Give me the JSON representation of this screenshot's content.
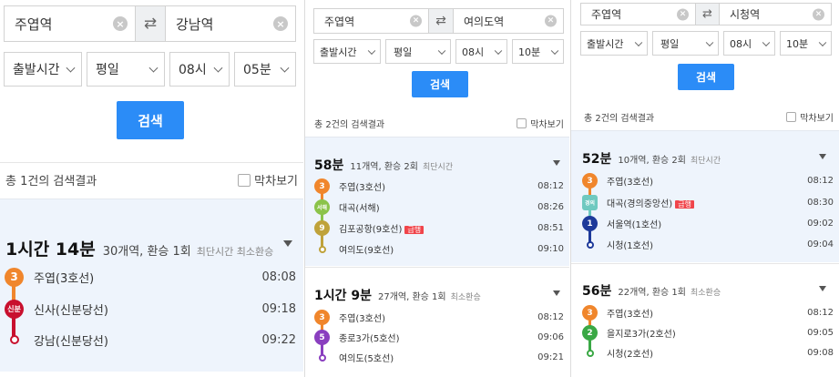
{
  "panel1": {
    "from": "주엽역",
    "to": "강남역",
    "dep_label": "출발시간",
    "day": "평일",
    "hour": "08시",
    "minute": "05분",
    "search": "검색",
    "result_count": "총 1건의 검색결과",
    "toggle": "막차보기",
    "routes": [
      {
        "time": "1시간 14분",
        "info": "30개역, 환승 1회",
        "tags": "최단시간 최소환승",
        "stops": [
          {
            "badge": "3",
            "name": "주엽(3호선)",
            "time": "08:08",
            "color": "#f0862c"
          },
          {
            "badge": "신분",
            "name": "신사(신분당선)",
            "time": "09:18",
            "color": "#c8102e"
          },
          {
            "badge": "",
            "name": "강남(신분당선)",
            "time": "09:22",
            "color": "#c8102e"
          }
        ]
      }
    ]
  },
  "panel2": {
    "from": "주엽역",
    "to": "여의도역",
    "dep_label": "출발시간",
    "day": "평일",
    "hour": "08시",
    "minute": "10분",
    "search": "검색",
    "result_count": "총 2건의 검색결과",
    "toggle": "막차보기",
    "routes": [
      {
        "time": "58분",
        "info": "11개역, 환승 2회",
        "tags": "최단시간",
        "stops": [
          {
            "badge": "3",
            "name": "주엽(3호선)",
            "time": "08:12",
            "color": "#f0862c"
          },
          {
            "badge": "서해",
            "name": "대곡(서해)",
            "time": "08:26",
            "color": "#8bc34a"
          },
          {
            "badge": "9",
            "name": "김포공항(9호선)",
            "time": "08:51",
            "color": "#bfa23a",
            "flag": "급행"
          },
          {
            "badge": "",
            "name": "여의도(9호선)",
            "time": "09:10",
            "color": "#bfa23a"
          }
        ]
      },
      {
        "time": "1시간 9분",
        "info": "27개역, 환승 1회",
        "tags": "최소환승",
        "stops": [
          {
            "badge": "3",
            "name": "주엽(3호선)",
            "time": "08:12",
            "color": "#f0862c"
          },
          {
            "badge": "5",
            "name": "종로3가(5호선)",
            "time": "09:06",
            "color": "#8a3fbf"
          },
          {
            "badge": "",
            "name": "여의도(5호선)",
            "time": "09:21",
            "color": "#8a3fbf"
          }
        ]
      }
    ]
  },
  "panel3": {
    "from": "주엽역",
    "to": "시청역",
    "dep_label": "출발시간",
    "day": "평일",
    "hour": "08시",
    "minute": "10분",
    "search": "검색",
    "result_count": "총 2건의 검색결과",
    "toggle": "막차보기",
    "routes": [
      {
        "time": "52분",
        "info": "10개역, 환승 2회",
        "tags": "최단시간",
        "stops": [
          {
            "badge": "3",
            "name": "주엽(3호선)",
            "time": "08:12",
            "color": "#f0862c"
          },
          {
            "badge": "경의",
            "name": "대곡(경의중앙선)",
            "time": "08:30",
            "color": "#6fc9c0",
            "flag": "급행"
          },
          {
            "badge": "1",
            "name": "서울역(1호선)",
            "time": "09:02",
            "color": "#1e3a9a"
          },
          {
            "badge": "",
            "name": "시청(1호선)",
            "time": "09:04",
            "color": "#1e3a9a"
          }
        ]
      },
      {
        "time": "56분",
        "info": "22개역, 환승 1회",
        "tags": "최소환승",
        "stops": [
          {
            "badge": "3",
            "name": "주엽(3호선)",
            "time": "08:12",
            "color": "#f0862c"
          },
          {
            "badge": "2",
            "name": "을지로3가(2호선)",
            "time": "09:05",
            "color": "#3aa845"
          },
          {
            "badge": "",
            "name": "시청(2호선)",
            "time": "09:08",
            "color": "#3aa845"
          }
        ]
      }
    ]
  },
  "icons": {
    "swap": "swap-arrows-icon",
    "clear": "clear-icon",
    "chevron": "chevron-down-icon",
    "expand": "triangle-down-icon"
  }
}
